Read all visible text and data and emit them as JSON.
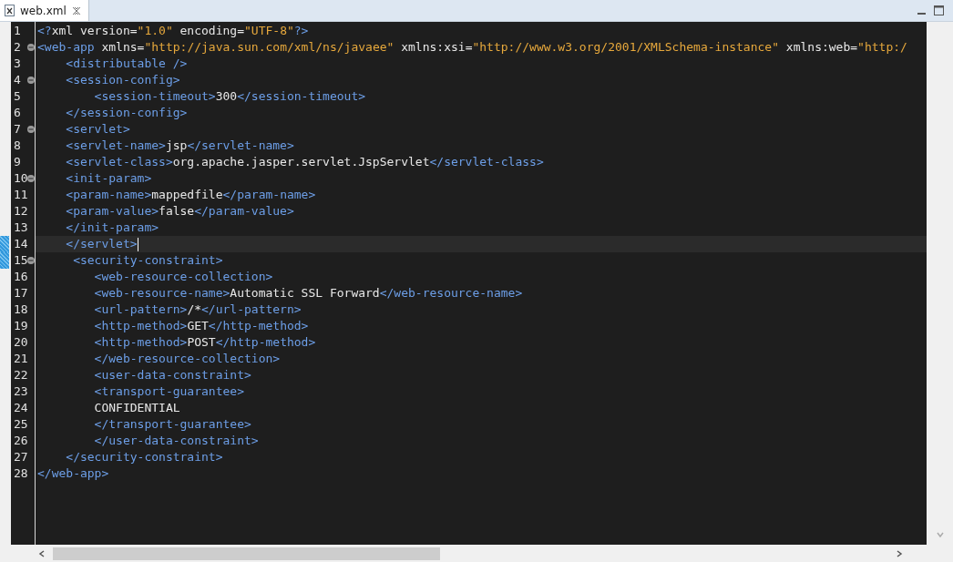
{
  "tabs": [
    {
      "label": "web.xml",
      "selected": true
    }
  ],
  "editor": {
    "lines": [
      {
        "number": "1",
        "fold": false,
        "changed": false,
        "current": false,
        "segments": [
          {
            "kind": "tag",
            "text": "<?"
          },
          {
            "kind": "text",
            "text": "xml version="
          },
          {
            "kind": "value",
            "text": "\"1.0\""
          },
          {
            "kind": "text",
            "text": " encoding="
          },
          {
            "kind": "value",
            "text": "\"UTF-8\""
          },
          {
            "kind": "tag",
            "text": "?>"
          }
        ]
      },
      {
        "number": "2",
        "fold": true,
        "changed": false,
        "current": false,
        "segments": [
          {
            "kind": "tag",
            "text": "<web-app"
          },
          {
            "kind": "text",
            "text": " xmlns="
          },
          {
            "kind": "value",
            "text": "\"http://java.sun.com/xml/ns/javaee\""
          },
          {
            "kind": "text",
            "text": " xmlns:xsi="
          },
          {
            "kind": "value",
            "text": "\"http://www.w3.org/2001/XMLSchema-instance\""
          },
          {
            "kind": "text",
            "text": " xmlns:web="
          },
          {
            "kind": "value",
            "text": "\"http:/"
          }
        ]
      },
      {
        "number": "3",
        "fold": false,
        "changed": false,
        "current": false,
        "segments": [
          {
            "kind": "tag",
            "text": "    <distributable />"
          }
        ]
      },
      {
        "number": "4",
        "fold": true,
        "changed": false,
        "current": false,
        "segments": [
          {
            "kind": "tag",
            "text": "    <session-config>"
          }
        ]
      },
      {
        "number": "5",
        "fold": false,
        "changed": false,
        "current": false,
        "segments": [
          {
            "kind": "tag",
            "text": "        <session-timeout>"
          },
          {
            "kind": "text",
            "text": "300"
          },
          {
            "kind": "tag",
            "text": "</session-timeout>"
          }
        ]
      },
      {
        "number": "6",
        "fold": false,
        "changed": false,
        "current": false,
        "segments": [
          {
            "kind": "tag",
            "text": "    </session-config>"
          }
        ]
      },
      {
        "number": "7",
        "fold": true,
        "changed": false,
        "current": false,
        "segments": [
          {
            "kind": "tag",
            "text": "    <servlet>"
          }
        ]
      },
      {
        "number": "8",
        "fold": false,
        "changed": false,
        "current": false,
        "segments": [
          {
            "kind": "tag",
            "text": "    <servlet-name>"
          },
          {
            "kind": "text",
            "text": "jsp"
          },
          {
            "kind": "tag",
            "text": "</servlet-name>"
          }
        ]
      },
      {
        "number": "9",
        "fold": false,
        "changed": false,
        "current": false,
        "segments": [
          {
            "kind": "tag",
            "text": "    <servlet-class>"
          },
          {
            "kind": "text",
            "text": "org.apache.jasper.servlet.JspServlet"
          },
          {
            "kind": "tag",
            "text": "</servlet-class>"
          }
        ]
      },
      {
        "number": "10",
        "fold": true,
        "changed": false,
        "current": false,
        "segments": [
          {
            "kind": "tag",
            "text": "    <init-param>"
          }
        ]
      },
      {
        "number": "11",
        "fold": false,
        "changed": false,
        "current": false,
        "segments": [
          {
            "kind": "tag",
            "text": "    <param-name>"
          },
          {
            "kind": "text",
            "text": "mappedfile"
          },
          {
            "kind": "tag",
            "text": "</param-name>"
          }
        ]
      },
      {
        "number": "12",
        "fold": false,
        "changed": false,
        "current": false,
        "segments": [
          {
            "kind": "tag",
            "text": "    <param-value>"
          },
          {
            "kind": "text",
            "text": "false"
          },
          {
            "kind": "tag",
            "text": "</param-value>"
          }
        ]
      },
      {
        "number": "13",
        "fold": false,
        "changed": false,
        "current": false,
        "segments": [
          {
            "kind": "tag",
            "text": "    </init-param>"
          }
        ]
      },
      {
        "number": "14",
        "fold": false,
        "changed": true,
        "current": true,
        "segments": [
          {
            "kind": "tag",
            "text": "    </servlet>"
          }
        ]
      },
      {
        "number": "15",
        "fold": true,
        "changed": true,
        "current": false,
        "segments": [
          {
            "kind": "tag",
            "text": "     <security-constraint>"
          }
        ]
      },
      {
        "number": "16",
        "fold": false,
        "changed": false,
        "current": false,
        "segments": [
          {
            "kind": "tag",
            "text": "        <web-resource-collection>"
          }
        ]
      },
      {
        "number": "17",
        "fold": false,
        "changed": false,
        "current": false,
        "segments": [
          {
            "kind": "tag",
            "text": "        <web-resource-name>"
          },
          {
            "kind": "text",
            "text": "Automatic SSL Forward"
          },
          {
            "kind": "tag",
            "text": "</web-resource-name>"
          }
        ]
      },
      {
        "number": "18",
        "fold": false,
        "changed": false,
        "current": false,
        "segments": [
          {
            "kind": "tag",
            "text": "        <url-pattern>"
          },
          {
            "kind": "text",
            "text": "/*"
          },
          {
            "kind": "tag",
            "text": "</url-pattern>"
          }
        ]
      },
      {
        "number": "19",
        "fold": false,
        "changed": false,
        "current": false,
        "segments": [
          {
            "kind": "tag",
            "text": "        <http-method>"
          },
          {
            "kind": "text",
            "text": "GET"
          },
          {
            "kind": "tag",
            "text": "</http-method>"
          }
        ]
      },
      {
        "number": "20",
        "fold": false,
        "changed": false,
        "current": false,
        "segments": [
          {
            "kind": "tag",
            "text": "        <http-method>"
          },
          {
            "kind": "text",
            "text": "POST"
          },
          {
            "kind": "tag",
            "text": "</http-method>"
          }
        ]
      },
      {
        "number": "21",
        "fold": false,
        "changed": false,
        "current": false,
        "segments": [
          {
            "kind": "tag",
            "text": "        </web-resource-collection>"
          }
        ]
      },
      {
        "number": "22",
        "fold": false,
        "changed": false,
        "current": false,
        "segments": [
          {
            "kind": "tag",
            "text": "        <user-data-constraint>"
          }
        ]
      },
      {
        "number": "23",
        "fold": false,
        "changed": false,
        "current": false,
        "segments": [
          {
            "kind": "tag",
            "text": "        <transport-guarantee>"
          }
        ]
      },
      {
        "number": "24",
        "fold": false,
        "changed": false,
        "current": false,
        "segments": [
          {
            "kind": "text",
            "text": "        CONFIDENTIAL"
          }
        ]
      },
      {
        "number": "25",
        "fold": false,
        "changed": false,
        "current": false,
        "segments": [
          {
            "kind": "tag",
            "text": "        </transport-guarantee>"
          }
        ]
      },
      {
        "number": "26",
        "fold": false,
        "changed": false,
        "current": false,
        "segments": [
          {
            "kind": "tag",
            "text": "        </user-data-constraint>"
          }
        ]
      },
      {
        "number": "27",
        "fold": false,
        "changed": false,
        "current": false,
        "segments": [
          {
            "kind": "tag",
            "text": "    </security-constraint>"
          }
        ]
      },
      {
        "number": "28",
        "fold": false,
        "changed": false,
        "current": false,
        "segments": [
          {
            "kind": "tag",
            "text": "</web-app>"
          }
        ]
      }
    ]
  }
}
